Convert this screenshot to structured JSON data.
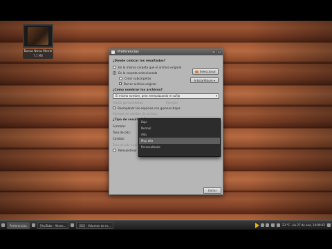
{
  "desktop_icon": {
    "label": "Bossa Nova Movie",
    "sublabel": "7.1 MB"
  },
  "dialog": {
    "title": "Preferencias",
    "section_where": "¿Dónde colocar los resultados?",
    "opt_same_folder": "En la misma carpeta que el archivo original",
    "opt_folder": "En la carpeta seleccionada",
    "btn_folder": "Seleccionar",
    "chk_subfolders": "Crear subcarpetas",
    "combo_subfolders": "Artista/Álbum",
    "chk_delete": "Borrar archivo original",
    "section_name": "¿Cómo nombrar los archivos?",
    "name_combo": "El mismo nombre, pero reemplazando el sufijo",
    "name_pattern_faint": "Patrón personalizado",
    "name_example_faint": "Ejemplo",
    "chk_replace": "Reemplazar los espacios con guiones bajos",
    "example_label": "Ejemplo de nombre de archivo",
    "section_type": "¿Tipo de resultado?",
    "field_format": "Formato:",
    "field_bitrate": "Tasa de bits:",
    "field_quality": "Calidad:",
    "sample_rate_note": "Tasa de bits original · 128 kbps",
    "chk_resample": "Remuestrear",
    "resample_unit": "Hz",
    "close_button": "Cerrar"
  },
  "dropdown": {
    "items": [
      "Bajo",
      "Normal",
      "Alto",
      "Muy alto",
      "Personalizado"
    ],
    "selected_index": 3
  },
  "taskbar": {
    "task1": "Preferencias",
    "task2": "[YouTube - Aliens...",
    "task3": "[SG] - Volumen de m...",
    "temp": "23 °C",
    "datetime": "vie 27 de ene, 14:09:02"
  },
  "colors": {
    "titlebar": "#4b4b4b",
    "dialog_bg": "#b6b6b6",
    "media_accent": "#e7b416",
    "wood": "#9b5634"
  }
}
